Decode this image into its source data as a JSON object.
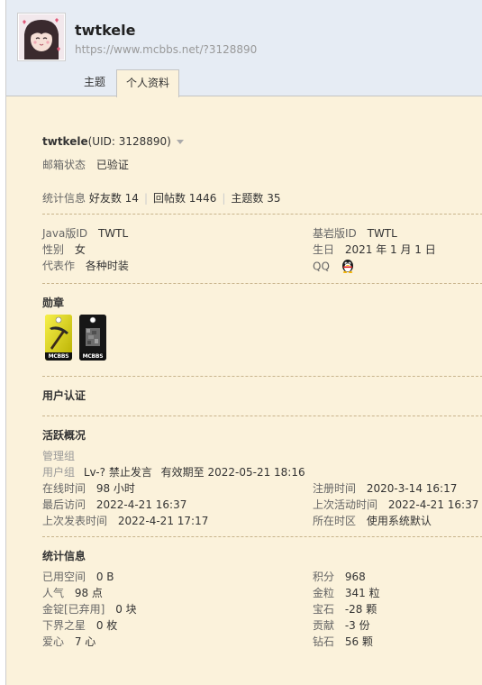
{
  "header": {
    "username": "twtkele",
    "url": "https://www.mcbbs.net/?3128890",
    "tabs": [
      "主题",
      "个人资料"
    ]
  },
  "profile": {
    "name": "twtkele",
    "uid_text": "(UID: 3128890)",
    "email_label": "邮箱状态",
    "email_value": "已验证",
    "stats_label": "统计信息",
    "friends": "好友数 14",
    "posts": "回帖数 1446",
    "threads": "主题数 35"
  },
  "info": {
    "java_label": "Java版ID",
    "java_value": "TWTL",
    "bedrock_label": "基岩版ID",
    "bedrock_value": "TWTL",
    "gender_label": "性别",
    "gender_value": "女",
    "birthday_label": "生日",
    "birthday_value": "2021 年 1 月 1 日",
    "works_label": "代表作",
    "works_value": "各种时装",
    "qq_label": "QQ"
  },
  "medals": {
    "title": "勋章",
    "items": [
      {
        "caption": "MCBBS",
        "icon": "pickaxe-icon",
        "bg": "#e8e000"
      },
      {
        "caption": "MCBBS",
        "icon": "ore-block-icon",
        "bg": "#1a1a1a"
      }
    ]
  },
  "auth": {
    "title": "用户认证"
  },
  "activity": {
    "title": "活跃概况",
    "admin_group_label": "管理组",
    "user_group_label": "用户组",
    "user_group_value": "Lv-? 禁止发言",
    "user_group_expiry": "有效期至 2022-05-21 18:16",
    "online_label": "在线时间",
    "online_value": "98 小时",
    "register_label": "注册时间",
    "register_value": "2020-3-14 16:17",
    "last_visit_label": "最后访问",
    "last_visit_value": "2022-4-21 16:37",
    "last_active_label": "上次活动时间",
    "last_active_value": "2022-4-21 16:37",
    "last_post_label": "上次发表时间",
    "last_post_value": "2022-4-21 17:17",
    "timezone_label": "所在时区",
    "timezone_value": "使用系统默认"
  },
  "statistics": {
    "title": "统计信息",
    "left": [
      {
        "label": "已用空间",
        "value": "0 B"
      },
      {
        "label": "人气",
        "value": "98 点"
      },
      {
        "label": "金锭[已弃用]",
        "value": "0 块"
      },
      {
        "label": "下界之星",
        "value": "0 枚"
      },
      {
        "label": "爱心",
        "value": "7 心"
      }
    ],
    "right": [
      {
        "label": "积分",
        "value": "968"
      },
      {
        "label": "金粒",
        "value": "341 粒"
      },
      {
        "label": "宝石",
        "value": "-28 颗"
      },
      {
        "label": "贡献",
        "value": "-3 份"
      },
      {
        "label": "钻石",
        "value": "56 颗"
      }
    ]
  }
}
